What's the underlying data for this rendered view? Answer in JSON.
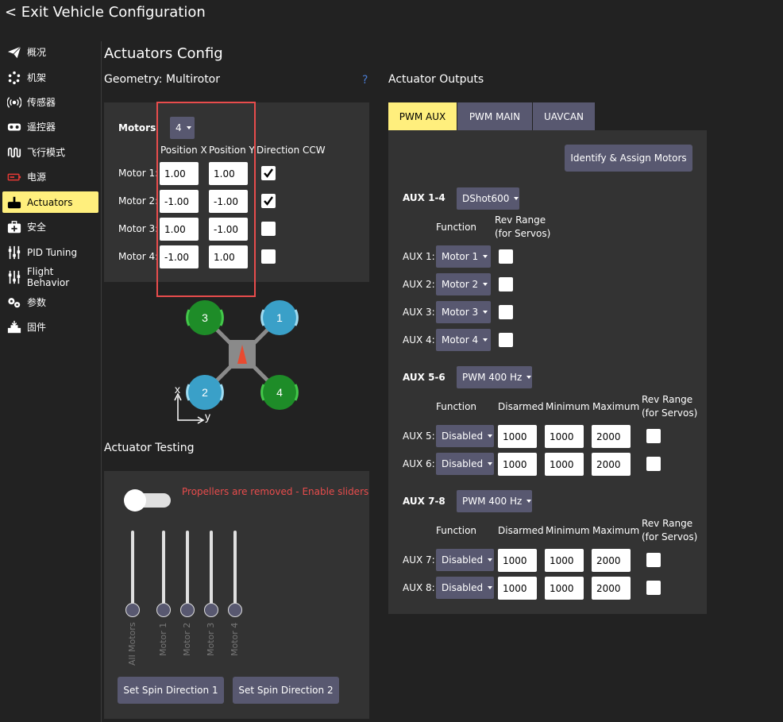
{
  "header": {
    "exit_label": "< Exit Vehicle Configuration"
  },
  "sidebar": {
    "items": [
      {
        "label": "概况",
        "icon": "paper-plane-icon"
      },
      {
        "label": "机架",
        "icon": "airframe-icon"
      },
      {
        "label": "传感器",
        "icon": "sensors-icon"
      },
      {
        "label": "遥控器",
        "icon": "radio-controller-icon"
      },
      {
        "label": "飞行模式",
        "icon": "flight-modes-icon"
      },
      {
        "label": "电源",
        "icon": "battery-icon"
      },
      {
        "label": "Actuators",
        "icon": "actuators-icon"
      },
      {
        "label": "安全",
        "icon": "safety-icon"
      },
      {
        "label": "PID Tuning",
        "icon": "tuning-sliders-icon"
      },
      {
        "label": "Flight Behavior",
        "icon": "flight-behavior-sliders-icon"
      },
      {
        "label": "参数",
        "icon": "parameters-gears-icon"
      },
      {
        "label": "固件",
        "icon": "firmware-icon"
      }
    ],
    "active_index": 6
  },
  "main": {
    "title": "Actuators Config",
    "geometry": {
      "title": "Geometry: Multirotor",
      "help": "?",
      "motors_label": "Motors",
      "motors_count": "4",
      "col_pos_x": "Position X",
      "col_pos_y": "Position Y",
      "col_dir": "Direction CCW",
      "rows": [
        {
          "label": "Motor 1:",
          "x": "1.00",
          "y": "1.00",
          "ccw": true
        },
        {
          "label": "Motor 2:",
          "x": "-1.00",
          "y": "-1.00",
          "ccw": true
        },
        {
          "label": "Motor 3:",
          "x": "1.00",
          "y": "-1.00",
          "ccw": false
        },
        {
          "label": "Motor 4:",
          "x": "-1.00",
          "y": "1.00",
          "ccw": false
        }
      ]
    },
    "diagram": {
      "motors": [
        "1",
        "2",
        "3",
        "4"
      ],
      "axis_x": "x",
      "axis_y": "y",
      "colors": {
        "ccw": "#1e8c28",
        "cw": "#3aa0c8",
        "frame": "#8a8a8a",
        "arrow": "#e84a30"
      }
    },
    "testing": {
      "title": "Actuator Testing",
      "warning": "Propellers are removed - Enable sliders",
      "sliders": [
        "All Motors",
        "Motor 1",
        "Motor 2",
        "Motor 3",
        "Motor 4"
      ],
      "btn_spin1": "Set Spin Direction 1",
      "btn_spin2": "Set Spin Direction 2"
    }
  },
  "outputs": {
    "title": "Actuator Outputs",
    "tabs": [
      "PWM AUX",
      "PWM MAIN",
      "UAVCAN"
    ],
    "active_tab": 0,
    "identify_btn": "Identify & Assign Motors",
    "group1": {
      "label": "AUX 1-4",
      "protocol": "DShot600",
      "col_function": "Function",
      "col_rev_line1": "Rev Range",
      "col_rev_line2": "(for Servos)",
      "rows": [
        {
          "label": "AUX 1:",
          "function": "Motor 1"
        },
        {
          "label": "AUX 2:",
          "function": "Motor 2"
        },
        {
          "label": "AUX 3:",
          "function": "Motor 3"
        },
        {
          "label": "AUX 4:",
          "function": "Motor 4"
        }
      ]
    },
    "group2": {
      "label": "AUX 5-6",
      "protocol": "PWM 400 Hz",
      "col_function": "Function",
      "col_disarmed": "Disarmed",
      "col_min": "Minimum",
      "col_max": "Maximum",
      "col_rev_line1": "Rev Range",
      "col_rev_line2": "(for Servos)",
      "rows": [
        {
          "label": "AUX 5:",
          "function": "Disabled",
          "disarmed": "1000",
          "min": "1000",
          "max": "2000"
        },
        {
          "label": "AUX 6:",
          "function": "Disabled",
          "disarmed": "1000",
          "min": "1000",
          "max": "2000"
        }
      ]
    },
    "group3": {
      "label": "AUX 7-8",
      "protocol": "PWM 400 Hz",
      "col_function": "Function",
      "col_disarmed": "Disarmed",
      "col_min": "Minimum",
      "col_max": "Maximum",
      "col_rev_line1": "Rev Range",
      "col_rev_line2": "(for Servos)",
      "rows": [
        {
          "label": "AUX 7:",
          "function": "Disabled",
          "disarmed": "1000",
          "min": "1000",
          "max": "2000"
        },
        {
          "label": "AUX 8:",
          "function": "Disabled",
          "disarmed": "1000",
          "min": "1000",
          "max": "2000"
        }
      ]
    }
  },
  "colors": {
    "accent": "#ffef7d",
    "panel": "#333333",
    "control": "#585870",
    "warning": "#e84c4c",
    "highlight_box": "#e84c4c"
  }
}
